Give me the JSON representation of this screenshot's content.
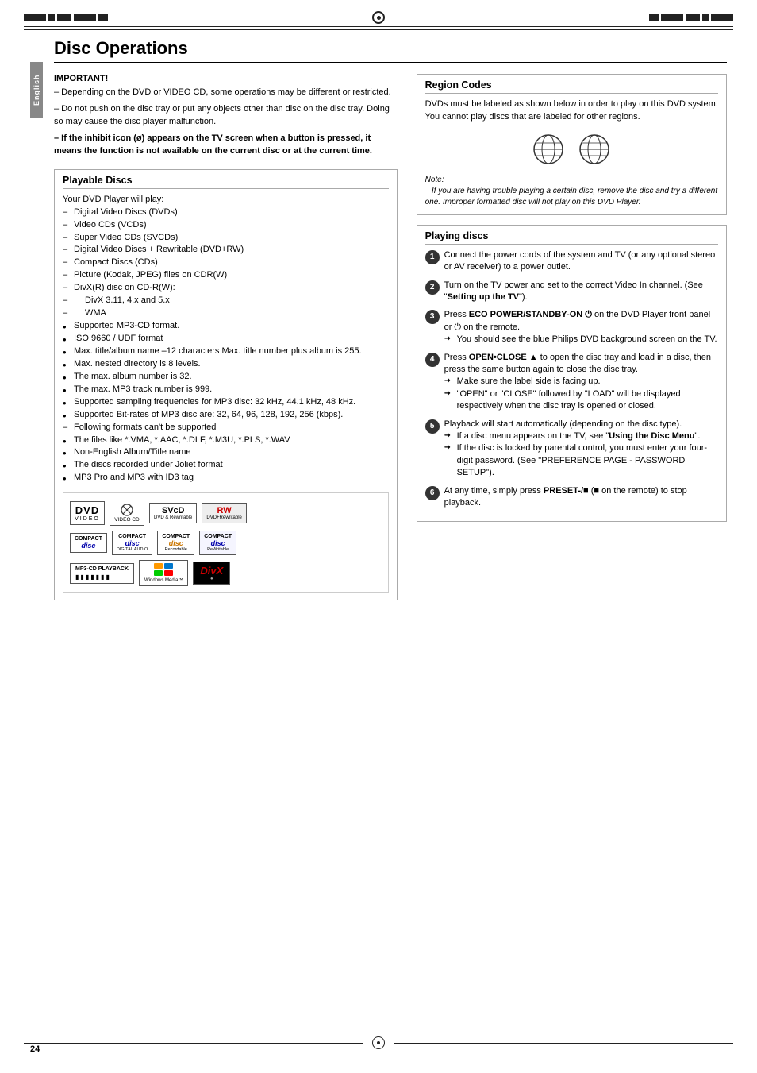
{
  "page": {
    "number": "24",
    "title": "Disc Operations"
  },
  "side_tab": {
    "label": "English"
  },
  "important": {
    "title": "IMPORTANT!",
    "paragraphs": [
      "– Depending on the DVD or VIDEO CD, some operations may be different or restricted.",
      "– Do not push on the disc tray or put any objects other than disc on the disc tray. Doing so may cause the disc player malfunction.",
      "– If the inhibit icon (ø) appears on the TV screen when a button is pressed, it means the function is not available on the current disc or at the current time."
    ]
  },
  "playable_discs": {
    "title": "Playable Discs",
    "intro": "Your DVD Player will play:",
    "items_dash": [
      "Digital Video Discs (DVDs)",
      "Video CDs (VCDs)",
      "Super Video CDs (SVCDs)",
      "Digital Video Discs + Rewritable (DVD+RW)",
      "Compact Discs (CDs)",
      "Picture (Kodak, JPEG) files on CDR(W)",
      "DivX(R) disc on CD-R(W):",
      "DivX 3.11, 4.x and 5.x",
      "WMA"
    ],
    "items_bullet": [
      "Supported MP3-CD format.",
      "ISO 9660 / UDF format",
      "Max. title/album name –12 characters Max. title number plus album is 255.",
      "Max. nested directory is 8 levels.",
      "The max. album number is 32.",
      "The max. MP3 track number is 999.",
      "Supported sampling frequencies for MP3 disc: 32 kHz, 44.1 kHz, 48 kHz.",
      "Supported Bit-rates of MP3 disc are: 32, 64, 96, 128, 192, 256 (kbps)."
    ],
    "items_dash2": [
      "Following formats can't be supported"
    ],
    "items_bullet2_files": "The files like *.VMA, *.AAC, *.DLF, *.M3U, *.PLS, *.WAV",
    "items_bullet2": [
      "Non-English Album/Title name",
      "The discs recorded under Joliet format",
      "MP3 Pro and MP3 with ID3 tag"
    ]
  },
  "region_codes": {
    "title": "Region Codes",
    "text": "DVDs must be labeled as shown below in order to play on this DVD system. You cannot play discs that are labeled for other regions.",
    "note_label": "Note:",
    "note_text": "– If you are having trouble playing a certain disc, remove the disc and try a different one. Improper formatted disc will not play on this DVD Player."
  },
  "playing_discs": {
    "title": "Playing discs",
    "steps": [
      {
        "num": "1",
        "text": "Connect the power cords of the system and TV (or any optional stereo or AV receiver) to a power outlet."
      },
      {
        "num": "2",
        "text": "Turn on the TV power and set to the correct Video In channel. (See \"",
        "bold": "Setting up the TV",
        "text2": "\")."
      },
      {
        "num": "3",
        "text": "Press ",
        "bold": "ECO POWER/STANDBY-ON",
        "symbol": "⏻",
        "text2": " on the DVD Player front panel or ",
        "symbol2": "⏻",
        "text3": " on the remote.",
        "arrow1": "You should see the blue Philips DVD background screen on the TV."
      },
      {
        "num": "4",
        "text": "Press ",
        "bold": "OPEN•CLOSE ▲",
        "text2": " to open the disc tray and load in a disc, then press the same button again to close the disc tray.",
        "arrow1": "Make sure the label side is facing up.",
        "arrow2": "\"OPEN\" or \"CLOSE\" followed by \"LOAD\" will be displayed respectively when the disc tray is opened or closed."
      },
      {
        "num": "5",
        "text": "Playback will start automatically (depending on the disc type).",
        "arrow1": "If a disc menu appears on the TV, see \"",
        "arrow1_bold": "Using the Disc Menu",
        "arrow1_end": "\".",
        "arrow2": "If the disc is locked by parental control, you must enter your four-digit password. (See \"PREFERENCE PAGE - PASSWORD SETUP\")."
      },
      {
        "num": "6",
        "text": "At any time, simply press ",
        "bold": "PRESET-/■",
        "symbol": "■",
        "text2": " (■ on the remote) to stop playback."
      }
    ]
  },
  "disc_logos": {
    "row1": [
      {
        "big": "DVD",
        "sub": "VIDEO"
      },
      {
        "big": "⊘",
        "sub": "VIDEO CD"
      },
      {
        "big": "SVD",
        "sub": "DVD & Rewritable"
      },
      {
        "big": "RW",
        "sub": "DVD+Rewritable"
      }
    ],
    "row2": [
      {
        "big": "disc",
        "sub": "COMPACT"
      },
      {
        "big": "disc",
        "sub": "COMPACT DIGITAL AUDIO"
      },
      {
        "big": "disc",
        "sub": "COMPACT Recordable"
      },
      {
        "big": "disc",
        "sub": "COMPACT ReWritable"
      }
    ],
    "row3": [
      {
        "big": "MP3-CD PLAYBACK",
        "sub": ""
      },
      {
        "big": "Windows Media™",
        "sub": ""
      },
      {
        "big": "DivX",
        "sub": ""
      }
    ]
  }
}
